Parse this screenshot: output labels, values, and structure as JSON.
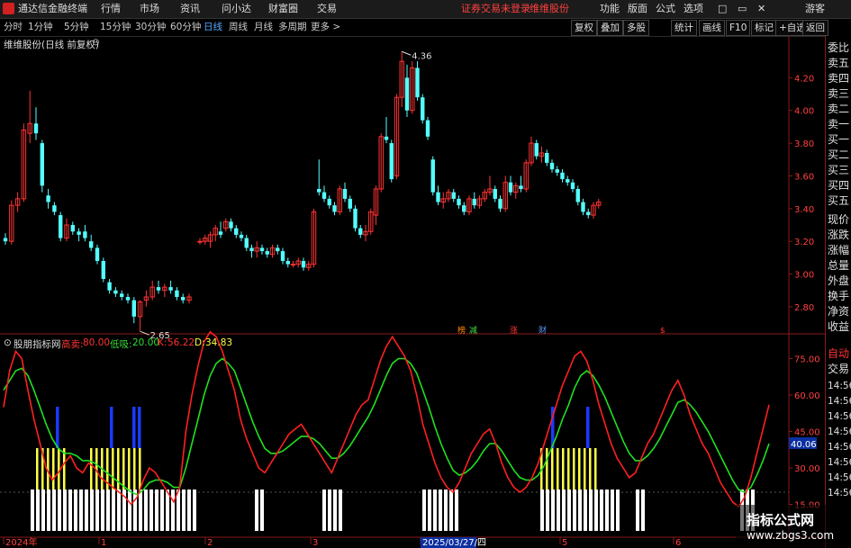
{
  "app": {
    "title": "通达信金融终端",
    "status_left": "证券交易未登录",
    "stock_name": "维维股份"
  },
  "menu": [
    "行情",
    "市场",
    "资讯",
    "问小达",
    "财富圈",
    "交易"
  ],
  "menu_right": [
    "功能",
    "版面",
    "公式",
    "选项"
  ],
  "guest": "游客",
  "window_controls": [
    "□",
    "▭",
    "✕"
  ],
  "periods": [
    "分时",
    "1分钟",
    "5分钟",
    "15分钟",
    "30分钟",
    "60分钟",
    "日线",
    "周线",
    "月线",
    "多周期",
    "更多 >"
  ],
  "period_active": "日线",
  "toolbar_right": [
    "复权",
    "叠加",
    "多股",
    "统计",
    "画线",
    "F10",
    "标记",
    "+自选",
    "返回"
  ],
  "chart_title": "维维股份(日线 前复权)",
  "right_panel": [
    "委比",
    "卖五",
    "卖四",
    "卖三",
    "卖二",
    "卖一",
    "买一",
    "买二",
    "买三",
    "买四",
    "买五",
    "现价",
    "涨跌",
    "涨幅",
    "总量",
    "外盘",
    "换手",
    "净资",
    "收益",
    "自动",
    "交易"
  ],
  "right_panel_lower": [
    "14:56",
    "14:56",
    "14:56",
    "14:56",
    "14:56",
    "14:56",
    "14:56",
    "14:56"
  ],
  "price_axis": [
    "4.20",
    "4.00",
    "3.80",
    "3.60",
    "3.40",
    "3.20",
    "3.00",
    "2.80"
  ],
  "price_markers": {
    "high": "4.36",
    "low": "2.65"
  },
  "event_markers": [
    "榜",
    "减",
    "涨",
    "财",
    "$"
  ],
  "indicator": {
    "name": "股朋指标网",
    "params": [
      {
        "label": "高卖:",
        "value": "80.00",
        "color": "#ff3333"
      },
      {
        "label": "低吸:",
        "value": "20.00",
        "color": "#33dd33"
      },
      {
        "label": "K:",
        "value": "56.22",
        "color": "#ff3333"
      },
      {
        "label": "D:",
        "value": "34.83",
        "color": "#ffff44"
      }
    ],
    "axis": [
      "75.00",
      "60.00",
      "45.00",
      "30.00",
      "15.00"
    ],
    "current_value": "40.06"
  },
  "date_axis": [
    "2024年",
    "1",
    "2",
    "3",
    "2025/03/27/四",
    "5",
    "6"
  ],
  "watermark": {
    "title": "指标公式网",
    "url": "www.zbgs3.com"
  },
  "colors": {
    "up": "#ff3333",
    "down": "#54ffff",
    "k_line": "#ff2020",
    "d_line": "#20e020",
    "bar_yellow": "#ffff44",
    "bar_blue": "#1a3aff",
    "bar_white": "#ffffff"
  },
  "chart_data": {
    "type": "candlestick",
    "price_range": [
      2.64,
      4.4
    ],
    "candles": [
      [
        3.22,
        3.25,
        3.18,
        3.2
      ],
      [
        3.2,
        3.45,
        3.18,
        3.42
      ],
      [
        3.42,
        3.5,
        3.38,
        3.46
      ],
      [
        3.46,
        3.92,
        3.44,
        3.88
      ],
      [
        3.86,
        4.12,
        3.8,
        3.92
      ],
      [
        3.92,
        4.02,
        3.82,
        3.86
      ],
      [
        3.8,
        3.82,
        3.5,
        3.54
      ],
      [
        3.48,
        3.52,
        3.4,
        3.44
      ],
      [
        3.42,
        3.44,
        3.36,
        3.38
      ],
      [
        3.36,
        3.38,
        3.2,
        3.22
      ],
      [
        3.22,
        3.34,
        3.2,
        3.3
      ],
      [
        3.3,
        3.32,
        3.24,
        3.26
      ],
      [
        3.26,
        3.28,
        3.2,
        3.24
      ],
      [
        3.26,
        3.3,
        3.2,
        3.22
      ],
      [
        3.2,
        3.24,
        3.14,
        3.16
      ],
      [
        3.16,
        3.18,
        3.06,
        3.08
      ],
      [
        3.08,
        3.1,
        2.95,
        2.97
      ],
      [
        2.95,
        2.97,
        2.88,
        2.9
      ],
      [
        2.9,
        2.92,
        2.86,
        2.88
      ],
      [
        2.88,
        2.9,
        2.84,
        2.86
      ],
      [
        2.86,
        2.88,
        2.82,
        2.84
      ],
      [
        2.84,
        2.86,
        2.7,
        2.74
      ],
      [
        2.74,
        2.84,
        2.65,
        2.83
      ],
      [
        2.84,
        2.9,
        2.8,
        2.86
      ],
      [
        2.86,
        2.96,
        2.84,
        2.92
      ],
      [
        2.92,
        2.96,
        2.88,
        2.9
      ],
      [
        2.9,
        2.94,
        2.86,
        2.92
      ],
      [
        2.92,
        2.96,
        2.88,
        2.9
      ],
      [
        2.9,
        2.92,
        2.84,
        2.86
      ],
      [
        2.86,
        2.88,
        2.82,
        2.84
      ],
      [
        2.84,
        2.88,
        2.82,
        2.86
      ],
      [
        3.2,
        3.22,
        3.18,
        3.2
      ],
      [
        3.2,
        3.24,
        3.18,
        3.22
      ],
      [
        3.2,
        3.26,
        3.16,
        3.24
      ],
      [
        3.24,
        3.3,
        3.2,
        3.28
      ],
      [
        3.26,
        3.32,
        3.22,
        3.24
      ],
      [
        3.28,
        3.34,
        3.26,
        3.32
      ],
      [
        3.32,
        3.34,
        3.26,
        3.28
      ],
      [
        3.28,
        3.3,
        3.22,
        3.24
      ],
      [
        3.24,
        3.26,
        3.2,
        3.22
      ],
      [
        3.22,
        3.24,
        3.14,
        3.16
      ],
      [
        3.16,
        3.18,
        3.1,
        3.14
      ],
      [
        3.14,
        3.2,
        3.1,
        3.16
      ],
      [
        3.16,
        3.18,
        3.12,
        3.14
      ],
      [
        3.14,
        3.16,
        3.1,
        3.12
      ],
      [
        3.12,
        3.18,
        3.1,
        3.16
      ],
      [
        3.16,
        3.18,
        3.12,
        3.14
      ],
      [
        3.14,
        3.16,
        3.06,
        3.08
      ],
      [
        3.08,
        3.1,
        3.04,
        3.06
      ],
      [
        3.06,
        3.08,
        3.04,
        3.06
      ],
      [
        3.06,
        3.1,
        3.04,
        3.08
      ],
      [
        3.08,
        3.1,
        3.02,
        3.04
      ],
      [
        3.04,
        3.08,
        3.02,
        3.06
      ],
      [
        3.06,
        3.4,
        3.04,
        3.38
      ],
      [
        3.52,
        3.7,
        3.48,
        3.5
      ],
      [
        3.5,
        3.54,
        3.44,
        3.46
      ],
      [
        3.46,
        3.48,
        3.4,
        3.42
      ],
      [
        3.42,
        3.44,
        3.36,
        3.38
      ],
      [
        3.38,
        3.54,
        3.36,
        3.52
      ],
      [
        3.52,
        3.56,
        3.44,
        3.46
      ],
      [
        3.46,
        3.48,
        3.38,
        3.4
      ],
      [
        3.4,
        3.42,
        3.26,
        3.28
      ],
      [
        3.28,
        3.3,
        3.22,
        3.24
      ],
      [
        3.24,
        3.3,
        3.2,
        3.26
      ],
      [
        3.26,
        3.4,
        3.24,
        3.38
      ],
      [
        3.36,
        3.54,
        3.3,
        3.52
      ],
      [
        3.52,
        3.86,
        3.5,
        3.84
      ],
      [
        3.84,
        3.96,
        3.8,
        3.82
      ],
      [
        3.8,
        3.82,
        3.56,
        3.58
      ],
      [
        3.6,
        4.1,
        3.58,
        4.08
      ],
      [
        4.08,
        4.36,
        4.02,
        4.3
      ],
      [
        4.2,
        4.28,
        3.96,
        4.0
      ],
      [
        4.0,
        4.3,
        3.98,
        4.26
      ],
      [
        4.26,
        4.3,
        4.06,
        4.08
      ],
      [
        4.08,
        4.1,
        3.92,
        3.94
      ],
      [
        3.94,
        3.96,
        3.82,
        3.84
      ],
      [
        3.7,
        3.72,
        3.48,
        3.5
      ],
      [
        3.5,
        3.54,
        3.42,
        3.44
      ],
      [
        3.44,
        3.5,
        3.4,
        3.46
      ],
      [
        3.46,
        3.52,
        3.44,
        3.5
      ],
      [
        3.5,
        3.52,
        3.44,
        3.46
      ],
      [
        3.46,
        3.48,
        3.4,
        3.42
      ],
      [
        3.42,
        3.44,
        3.36,
        3.38
      ],
      [
        3.38,
        3.48,
        3.36,
        3.46
      ],
      [
        3.46,
        3.5,
        3.4,
        3.42
      ],
      [
        3.42,
        3.48,
        3.4,
        3.46
      ],
      [
        3.46,
        3.52,
        3.44,
        3.5
      ],
      [
        3.5,
        3.6,
        3.48,
        3.52
      ],
      [
        3.52,
        3.54,
        3.44,
        3.46
      ],
      [
        3.46,
        3.48,
        3.38,
        3.4
      ],
      [
        3.4,
        3.6,
        3.38,
        3.56
      ],
      [
        3.56,
        3.6,
        3.48,
        3.5
      ],
      [
        3.5,
        3.56,
        3.46,
        3.54
      ],
      [
        3.54,
        3.6,
        3.5,
        3.52
      ],
      [
        3.52,
        3.7,
        3.5,
        3.68
      ],
      [
        3.68,
        3.84,
        3.66,
        3.8
      ],
      [
        3.8,
        3.82,
        3.7,
        3.72
      ],
      [
        3.72,
        3.78,
        3.68,
        3.74
      ],
      [
        3.74,
        3.76,
        3.66,
        3.68
      ],
      [
        3.68,
        3.7,
        3.62,
        3.64
      ],
      [
        3.64,
        3.66,
        3.6,
        3.62
      ],
      [
        3.62,
        3.64,
        3.56,
        3.58
      ],
      [
        3.58,
        3.6,
        3.54,
        3.56
      ],
      [
        3.56,
        3.58,
        3.5,
        3.52
      ],
      [
        3.52,
        3.54,
        3.42,
        3.44
      ],
      [
        3.44,
        3.46,
        3.36,
        3.38
      ],
      [
        3.38,
        3.4,
        3.34,
        3.36
      ],
      [
        3.36,
        3.44,
        3.34,
        3.42
      ],
      [
        3.42,
        3.46,
        3.4,
        3.44
      ]
    ],
    "k_series": [
      55,
      70,
      78,
      75,
      62,
      50,
      40,
      30,
      25,
      28,
      32,
      35,
      30,
      28,
      32,
      30,
      26,
      24,
      22,
      20,
      18,
      15,
      18,
      25,
      30,
      28,
      24,
      20,
      16,
      22,
      45,
      60,
      72,
      82,
      86,
      84,
      78,
      70,
      62,
      50,
      42,
      36,
      30,
      28,
      32,
      36,
      40,
      44,
      46,
      48,
      44,
      40,
      36,
      32,
      28,
      34,
      40,
      46,
      52,
      56,
      58,
      66,
      74,
      80,
      84,
      80,
      76,
      70,
      60,
      48,
      40,
      32,
      26,
      22,
      20,
      24,
      30,
      36,
      40,
      44,
      46,
      40,
      32,
      26,
      22,
      20,
      22,
      26,
      32,
      40,
      48,
      56,
      64,
      70,
      76,
      78,
      74,
      66,
      56,
      48,
      40,
      34,
      30,
      26,
      28,
      34,
      40,
      44,
      50,
      56,
      62,
      66,
      60,
      52,
      46,
      40,
      36,
      30,
      24,
      20,
      16,
      14,
      18,
      26,
      36,
      46,
      56
    ],
    "d_series": [
      62,
      66,
      70,
      71,
      68,
      62,
      55,
      48,
      42,
      38,
      36,
      36,
      35,
      33,
      33,
      32,
      30,
      28,
      26,
      24,
      22,
      20,
      19,
      21,
      24,
      25,
      25,
      24,
      22,
      22,
      30,
      40,
      50,
      60,
      68,
      73,
      75,
      73,
      70,
      63,
      56,
      49,
      43,
      38,
      36,
      36,
      37,
      39,
      41,
      43,
      43,
      42,
      40,
      37,
      34,
      34,
      36,
      39,
      43,
      47,
      51,
      56,
      62,
      68,
      73,
      75,
      75,
      73,
      69,
      62,
      55,
      47,
      40,
      34,
      29,
      27,
      28,
      30,
      33,
      37,
      40,
      40,
      37,
      33,
      29,
      26,
      25,
      25,
      27,
      31,
      37,
      43,
      50,
      56,
      63,
      68,
      70,
      68,
      64,
      59,
      53,
      47,
      41,
      36,
      33,
      33,
      35,
      38,
      42,
      47,
      52,
      57,
      58,
      56,
      53,
      49,
      45,
      40,
      35,
      30,
      25,
      21,
      20,
      22,
      27,
      33,
      40
    ],
    "white_bars": [
      [
        34,
        217
      ],
      [
        283,
        290
      ],
      [
        358,
        381
      ],
      [
        469,
        506
      ],
      [
        600,
        688
      ],
      [
        706,
        716
      ],
      [
        822,
        838
      ]
    ],
    "yellow_bars": [
      [
        40,
        75
      ],
      [
        100,
        158
      ],
      [
        600,
        662
      ]
    ],
    "blue_bars": [
      62,
      122,
      147,
      153,
      612,
      651
    ]
  }
}
